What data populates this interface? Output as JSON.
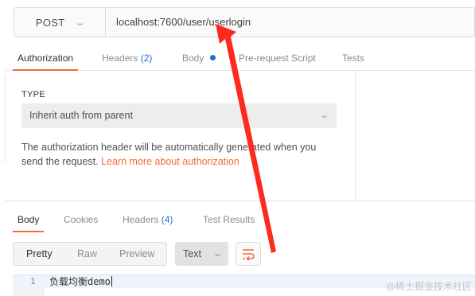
{
  "request": {
    "method": "POST",
    "url": "localhost:7600/user/userlogin"
  },
  "request_tabs": [
    {
      "label": "Authorization"
    },
    {
      "label": "Headers",
      "count": "(2)"
    },
    {
      "label": "Body"
    },
    {
      "label": "Pre-request Script"
    },
    {
      "label": "Tests"
    }
  ],
  "auth": {
    "type_label": "TYPE",
    "selected": "Inherit auth from parent",
    "description": "The authorization header will be automatically generated when you send the request.",
    "link": "Learn more about authorization"
  },
  "response_tabs": [
    {
      "label": "Body"
    },
    {
      "label": "Cookies"
    },
    {
      "label": "Headers",
      "count": "(4)"
    },
    {
      "label": "Test Results"
    }
  ],
  "view_modes": {
    "pretty": "Pretty",
    "raw": "Raw",
    "preview": "Preview",
    "format": "Text"
  },
  "code": {
    "line_number": "1",
    "content": "负载均衡demo"
  },
  "watermark": "@稀土掘金技术社区",
  "colors": {
    "accent": "#f26b3a",
    "count_blue": "#1e6fd6",
    "annotation_arrow": "#ff2a1f"
  },
  "icons": {
    "method_chevron": "chevron-down-icon",
    "select_chevron": "chevron-down-icon",
    "wrap": "wrap-lines-icon",
    "body_indicator": "dot-indicator-icon",
    "annotation": "red-arrow-icon"
  }
}
